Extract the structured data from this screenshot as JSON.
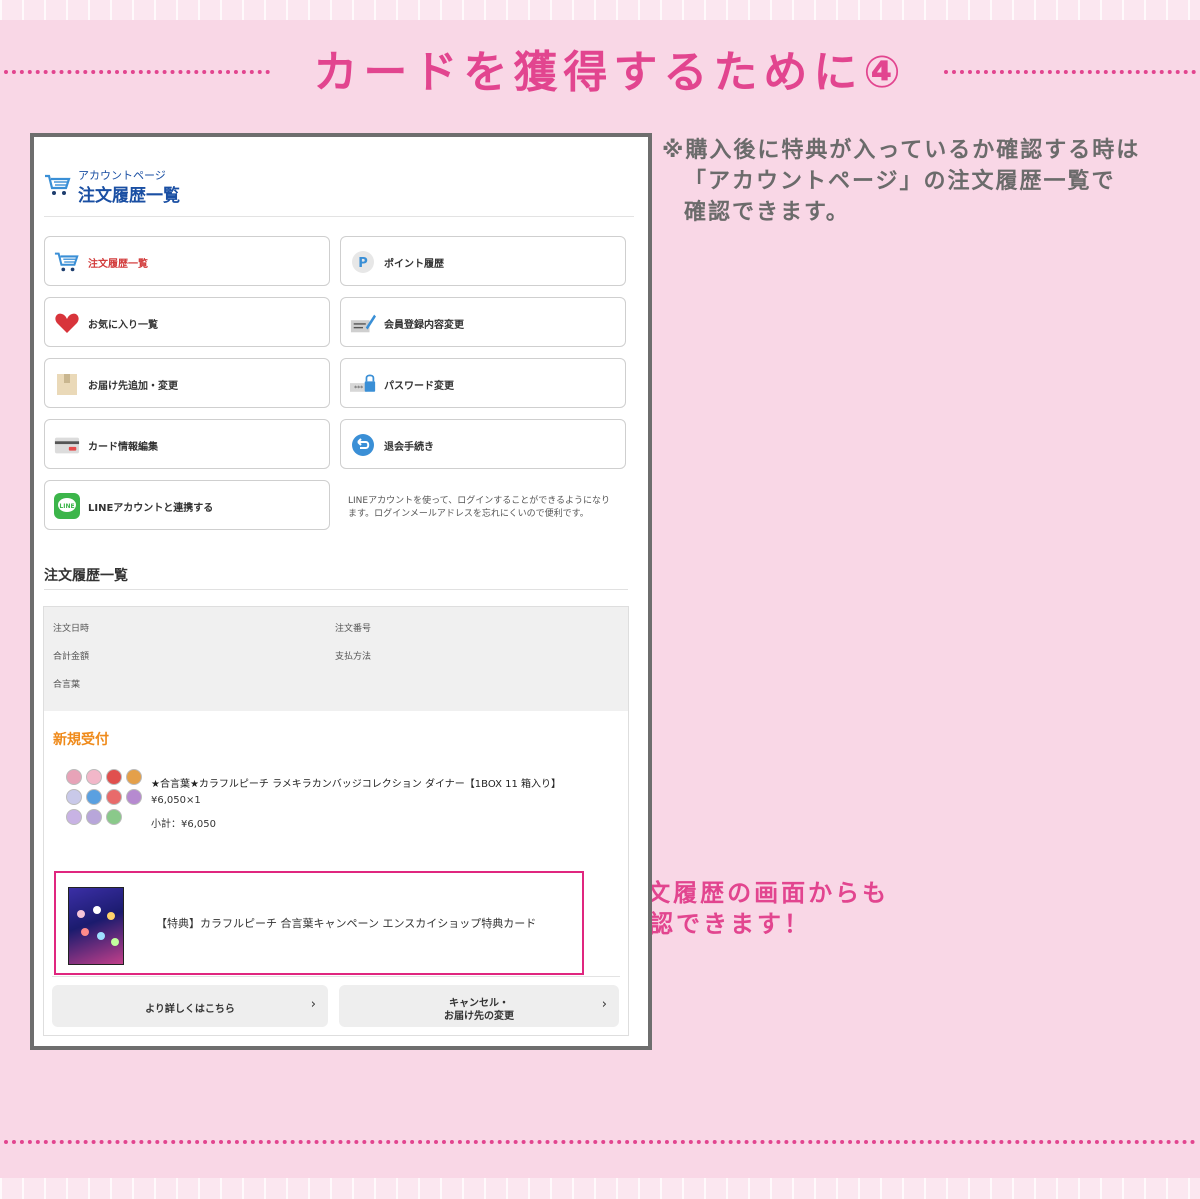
{
  "heading": "カードを獲得するために④",
  "note_top": {
    "line1": "※購入後に特典が入っているか確認する時は",
    "line2": "「アカウントページ」の注文履歴一覧で",
    "line3": "確認できます。"
  },
  "note_side": {
    "line1": "←注文履歴の画面からも",
    "line2": "確認できます！"
  },
  "account": {
    "subtitle": "アカウントページ",
    "title": "注文履歴一覧"
  },
  "menu": [
    {
      "label": "注文履歴一覧",
      "icon": "cart-icon"
    },
    {
      "label": "ポイント履歴",
      "icon": "point-icon"
    },
    {
      "label": "お気に入り一覧",
      "icon": "heart-icon"
    },
    {
      "label": "会員登録内容変更",
      "icon": "edit-profile-icon"
    },
    {
      "label": "お届け先追加・変更",
      "icon": "box-icon"
    },
    {
      "label": "パスワード変更",
      "icon": "lock-icon"
    },
    {
      "label": "カード情報編集",
      "icon": "credit-card-icon"
    },
    {
      "label": "退会手続き",
      "icon": "return-icon"
    },
    {
      "label": "LINEアカウントと連携する",
      "icon": "line-icon"
    }
  ],
  "line_note": "LINEアカウントを使って、ログインすることができるようになります。ログインメールアドレスを忘れにくいので便利です。",
  "history_title": "注文履歴一覧",
  "order": {
    "labels": {
      "date": "注文日時",
      "number": "注文番号",
      "total": "合計金額",
      "payment": "支払方法",
      "code": "合言葉"
    },
    "status": "新規受付",
    "product_name": "★合言葉★カラフルピーチ ラメキラカンバッジコレクション ダイナー【1BOX 11 箱入り】",
    "product_price": "¥6,050×1",
    "product_subtotal": "小計：¥6,050",
    "bonus_label": "【特典】カラフルピーチ 合言葉キャンペーン エンスカイショップ特典カード",
    "btn_details": "より詳しくはこちら",
    "btn_cancel_1": "キャンセル・",
    "btn_cancel_2": "お届け先の変更"
  },
  "colors": {
    "accent_pink": "#e2458f",
    "background": "#f9d7e6",
    "account_blue": "#1a4fa3",
    "status_orange": "#ef8a1a",
    "highlight_border": "#e0267f"
  }
}
